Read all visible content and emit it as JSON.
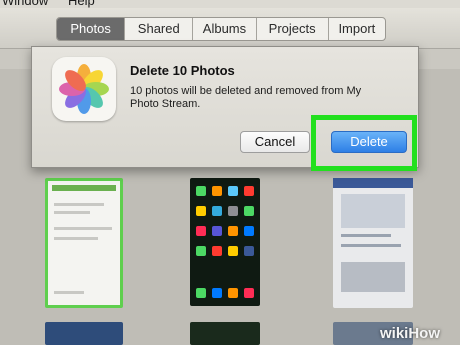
{
  "menubar": {
    "items": [
      "Window",
      "Help"
    ]
  },
  "toolbar": {
    "tabs": [
      "Photos",
      "Shared",
      "Albums",
      "Projects",
      "Import"
    ],
    "active": "Photos"
  },
  "dialog": {
    "title": "Delete 10 Photos",
    "message": "10 photos will be deleted and removed from My Photo Stream.",
    "cancel_label": "Cancel",
    "delete_label": "Delete",
    "icon": "photos-app-icon"
  },
  "colors": {
    "highlight": "#22e01e",
    "delete_button": "#2d7fe6"
  },
  "watermark": "wikiHow"
}
